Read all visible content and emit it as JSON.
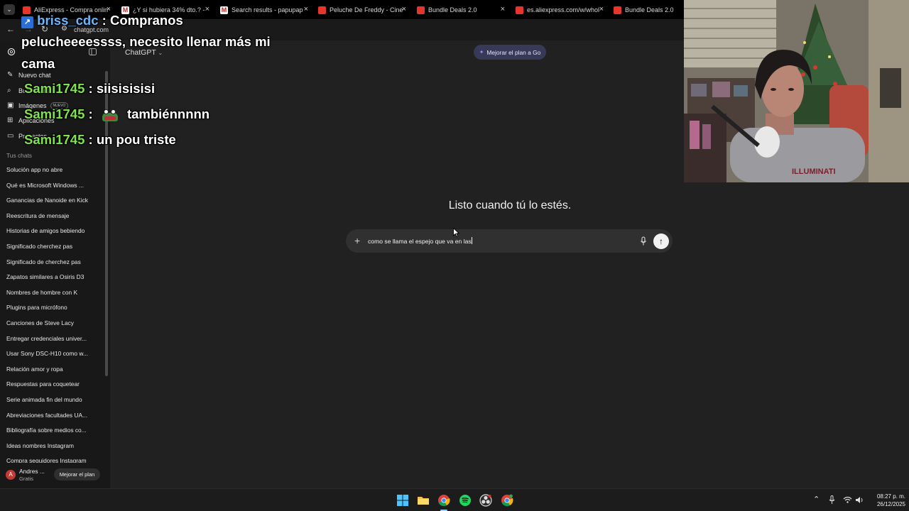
{
  "browser": {
    "tabs": [
      {
        "label": "AliExpress - Compra onlin",
        "color": "#e6352b"
      },
      {
        "label": "¿Y si hubiera 34% dto.? -",
        "color": "#ffffff"
      },
      {
        "label": "Search results - papupap",
        "color": "#ffffff"
      },
      {
        "label": "Peluche De Freddy - Cine",
        "color": "#e6352b"
      },
      {
        "label": "Bundle Deals 2.0",
        "color": "#e6352b"
      },
      {
        "label": "es.aliexpress.com/w/whol",
        "color": "#e6352b"
      },
      {
        "label": "Bundle Deals 2.0",
        "color": "#e6352b"
      }
    ],
    "url": "chatgpt.com"
  },
  "sidebar": {
    "nav": [
      {
        "label": "Nuevo chat",
        "icon": "compose-icon"
      },
      {
        "label": "Buscar chats",
        "icon": "search-icon"
      },
      {
        "label": "Imágenes",
        "icon": "images-icon",
        "badge": "NUEVO"
      },
      {
        "label": "Aplicaciones",
        "icon": "apps-icon"
      },
      {
        "label": "Proyectos",
        "icon": "folder-icon"
      }
    ],
    "section_title": "Tus chats",
    "chats": [
      "Solución app no abre",
      "Qué es Microsoft Windows ...",
      "Ganancias de Nanoide en Kick",
      "Reescritura de mensaje",
      "Historias de amigos bebiendo",
      "Significado cherchez pas",
      "Significado de cherchez pas",
      "Zapatos similares a Osiris D3",
      "Nombres de hombre con K",
      "Plugins para micrófono",
      "Canciones de Steve Lacy",
      "Entregar credenciales univer...",
      "Usar Sony DSC-H10 como w...",
      "Relación amor y ropa",
      "Respuestas para coquetear",
      "Serie animada fin del mundo",
      "Abreviaciones facultades UA...",
      "Bibliografía sobre medios co...",
      "Ideas nombres Instagram",
      "Compra seguidores Instagram"
    ],
    "user": {
      "initial": "A",
      "name": "Andres ...",
      "plan": "Gratis",
      "upgrade_label": "Mejorar el plan"
    }
  },
  "main": {
    "model": "ChatGPT",
    "upgrade_go": "Mejorar el plan a Go",
    "heading": "Listo cuando tú lo estés.",
    "composer_text": "como se llama el espejo que va en las"
  },
  "overlay": [
    {
      "user": "briss_cdc",
      "message": ": Compranos"
    },
    {
      "user": "",
      "message": "pelucheeeessss, necesito llenar más mi"
    },
    {
      "user": "",
      "message": "cama"
    },
    {
      "user": "Sami1745",
      "message": ": siisisisisi"
    },
    {
      "user": "Sami1745",
      "message": "tambiénnnnn"
    },
    {
      "user": "Sami1745",
      "message": ": un pou triste"
    }
  ],
  "overlay_colon": ":",
  "taskbar": {
    "time": "08:27 p. m.",
    "date": "26/12/2025",
    "apps": [
      "windows-start-icon",
      "file-explorer-icon",
      "chrome-icon",
      "spotify-icon",
      "obs-icon",
      "chrome-profile-icon"
    ]
  }
}
